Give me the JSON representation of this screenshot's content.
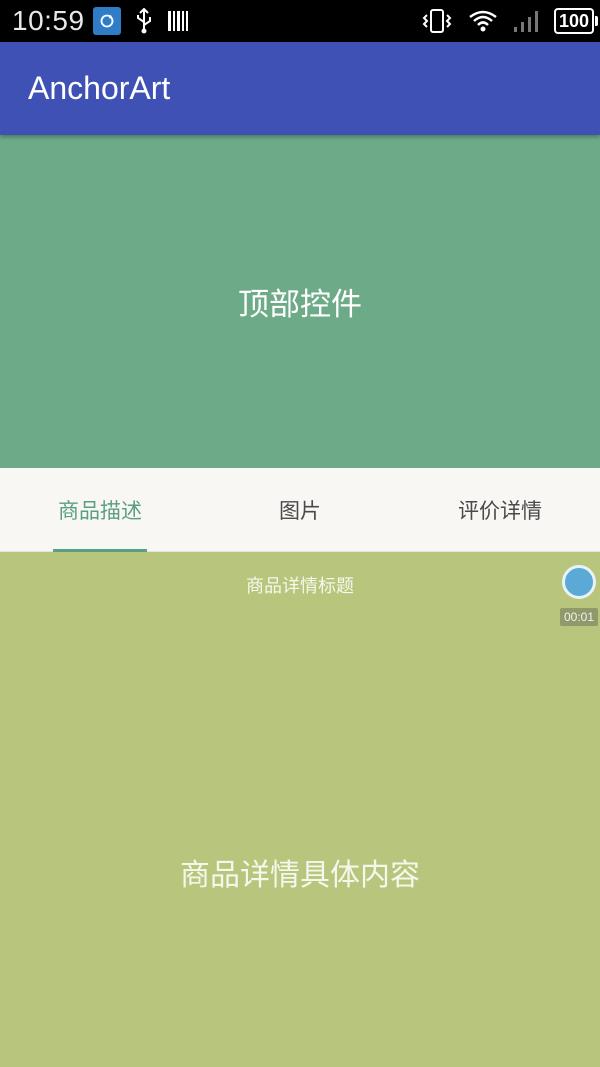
{
  "status_bar": {
    "time": "10:59",
    "battery": "100",
    "icons": [
      "sync-icon",
      "usb-icon",
      "barcode-icon",
      "vibrate-icon",
      "wifi-icon",
      "signal-icon",
      "battery-icon"
    ]
  },
  "app_bar": {
    "title": "AnchorArt"
  },
  "top_panel": {
    "text": "顶部控件"
  },
  "tabs": [
    {
      "label": "商品描述",
      "active": true
    },
    {
      "label": "图片",
      "active": false
    },
    {
      "label": "评价详情",
      "active": false
    }
  ],
  "content": {
    "title": "商品详情标题",
    "body": "商品详情具体内容"
  },
  "floating": {
    "timer": "00:01"
  },
  "colors": {
    "app_bar": "#3f51b5",
    "top_panel": "#6daa88",
    "accent": "#5b9e86",
    "content_bg": "#b7c67c"
  }
}
